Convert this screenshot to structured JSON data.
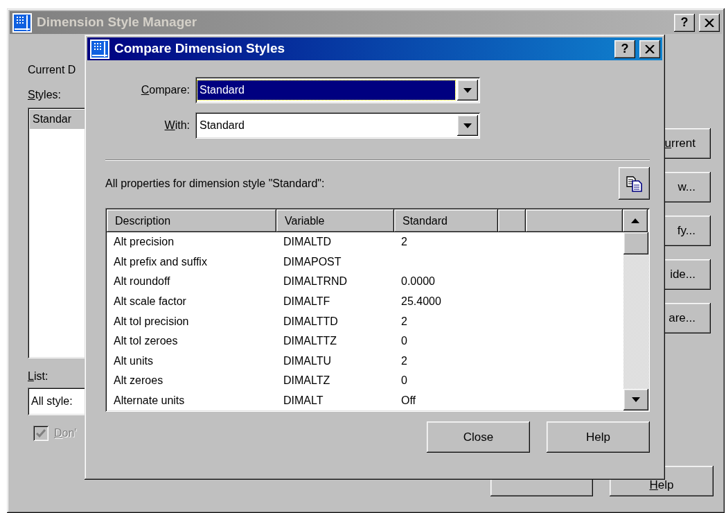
{
  "background_window": {
    "title": "Dimension Style Manager",
    "active": false,
    "title_buttons": [
      "?"
    ],
    "current_label": "Current D",
    "styles_label": {
      "text": "Styles:",
      "mnemonic_underlined": true
    },
    "styles": [
      {
        "name": "Standar",
        "selected": true
      }
    ],
    "list_label": {
      "text": "List:",
      "mnemonic_underlined": true
    },
    "list_value": "All style:",
    "checkbox": {
      "label": "Don'",
      "mnemonic_underlined": true,
      "checked": true,
      "disabled": true
    },
    "side_buttons": [
      {
        "label": "urrent",
        "mnemonic_underlined": true
      },
      {
        "label": "w..."
      },
      {
        "label": "fy..."
      },
      {
        "label": "ide..."
      },
      {
        "label": "are..."
      }
    ],
    "bottom_buttons": [
      {
        "kind": "covered"
      },
      {
        "kind": "labelled",
        "label": "Help",
        "mnemonic_underlined": true
      }
    ]
  },
  "front_window": {
    "title": "Compare Dimension Styles",
    "active": true,
    "title_buttons": [
      "?"
    ],
    "compare": {
      "label": "Compare:",
      "mnemonic_underlined": true,
      "value": "Standard",
      "focused": true
    },
    "with": {
      "label": "With:",
      "mnemonic_underlined": true,
      "value": "Standard",
      "focused": false
    },
    "properties_label": "All properties for dimension style \"Standard\":",
    "table": {
      "columns": [
        {
          "label": "Description"
        },
        {
          "label": "Variable"
        },
        {
          "label": "Standard"
        },
        {},
        {}
      ],
      "rows": [
        {
          "description": "Alt precision",
          "variable": "DIMALTD",
          "value": "2"
        },
        {
          "description": "Alt prefix and suffix",
          "variable": "DIMAPOST"
        },
        {
          "description": "Alt roundoff",
          "variable": "DIMALTRND",
          "value": "0.0000"
        },
        {
          "description": "Alt scale factor",
          "variable": "DIMALTF",
          "value": "25.4000"
        },
        {
          "description": "Alt tol precision",
          "variable": "DIMALTTD",
          "value": "2"
        },
        {
          "description": "Alt tol zeroes",
          "variable": "DIMALTTZ",
          "value": "0"
        },
        {
          "description": "Alt units",
          "variable": "DIMALTU",
          "value": "2"
        },
        {
          "description": "Alt zeroes",
          "variable": "DIMALTZ",
          "value": "0"
        },
        {
          "description": "Alternate units",
          "variable": "DIMALT",
          "value": "Off"
        }
      ]
    },
    "buttons": [
      {
        "label": "Close"
      },
      {
        "label": "Help"
      }
    ]
  }
}
